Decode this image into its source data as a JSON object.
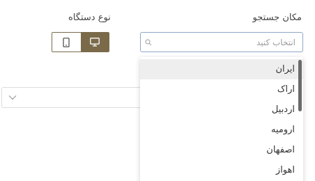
{
  "filters": {
    "location_label": "مکان جستجو",
    "device_label": "نوع دستگاه"
  },
  "search": {
    "placeholder": "انتخاب کنید",
    "value": ""
  },
  "device_toggle": {
    "options": [
      "mobile",
      "desktop"
    ],
    "selected": "desktop",
    "accent_color": "#7a6a4a"
  },
  "dropdown": {
    "options": [
      {
        "label": "ایران",
        "highlighted": true
      },
      {
        "label": "اراک",
        "highlighted": false
      },
      {
        "label": "اردبیل",
        "highlighted": false
      },
      {
        "label": "ارومیه",
        "highlighted": false
      },
      {
        "label": "اصفهان",
        "highlighted": false
      },
      {
        "label": "اهواز",
        "highlighted": false
      }
    ]
  },
  "icons": {
    "search": "search-icon",
    "mobile": "mobile-icon",
    "desktop": "desktop-icon",
    "chevron": "chevron-down-icon"
  }
}
